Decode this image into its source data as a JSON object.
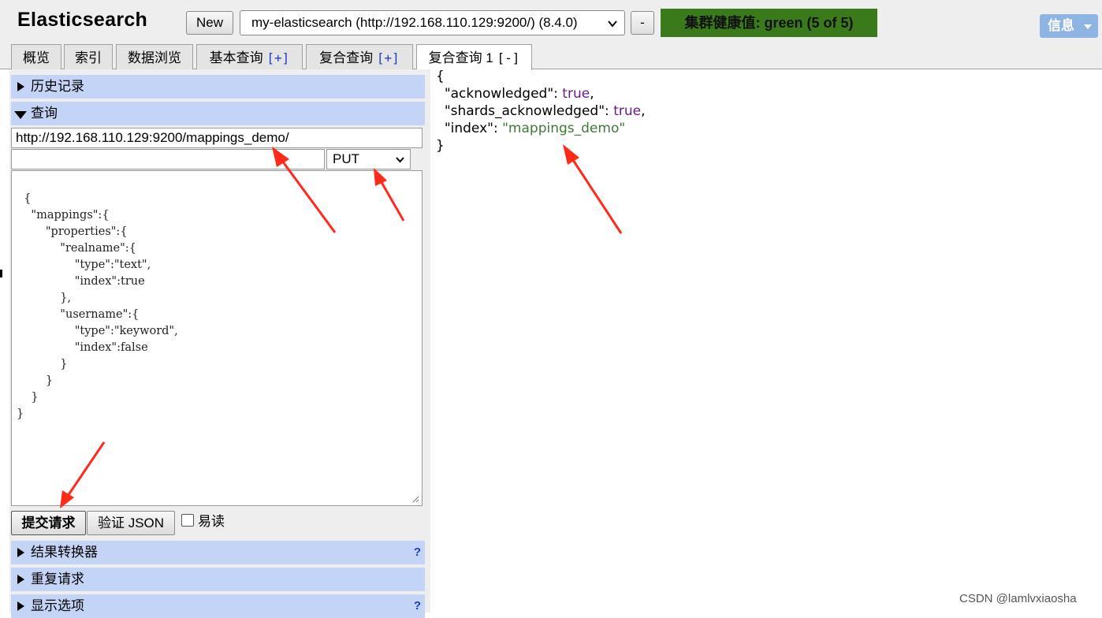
{
  "header": {
    "app_title": "Elasticsearch",
    "new_label": "New",
    "cluster_selected": "my-elasticsearch (http://192.168.110.129:9200/) (8.4.0)",
    "remove_label": "-",
    "health_label": "集群健康值: green (5 of 5)",
    "info_label": "信息",
    "health_color": "#3b7a1a"
  },
  "tabs": [
    {
      "label": "概览"
    },
    {
      "label": "索引"
    },
    {
      "label": "数据浏览"
    },
    {
      "label": "基本查询",
      "suffix": "[+]"
    },
    {
      "label": "复合查询",
      "suffix": "[+]"
    },
    {
      "label": "复合查询 1",
      "suffix": "[-]",
      "active": true
    }
  ],
  "left": {
    "history_label": "历史记录",
    "query_label": "查询",
    "url_value": "http://192.168.110.129:9200/mappings_demo/",
    "path_value": "",
    "method_selected": "PUT",
    "body_text": "{\n    \"mappings\":{\n        \"properties\":{\n            \"realname\":{\n                \"type\":\"text\",\n                \"index\":true\n            },\n            \"username\":{\n                \"type\":\"keyword\",\n                \"index\":false\n            }\n        }\n    }\n}",
    "submit_label": "提交请求",
    "validate_label": "验证 JSON",
    "pretty_label": "易读",
    "transformer_label": "结果转换器",
    "repeat_label": "重复请求",
    "display_label": "显示选项",
    "help_mark": "?"
  },
  "result": {
    "open": "{",
    "line1_key": "\"acknowledged\"",
    "line1_val": "true",
    "line2_key": "\"shards_acknowledged\"",
    "line2_val": "true",
    "line3_key": "\"index\"",
    "line3_val": "\"mappings_demo\"",
    "close": "}"
  },
  "watermark": "CSDN @lamlvxiaosha",
  "colors": {
    "section_bg": "#c4d4f7",
    "annotation_arrow": "#ff2a1a",
    "json_string": "#3d7a35",
    "json_bool": "#6a1b8a"
  }
}
